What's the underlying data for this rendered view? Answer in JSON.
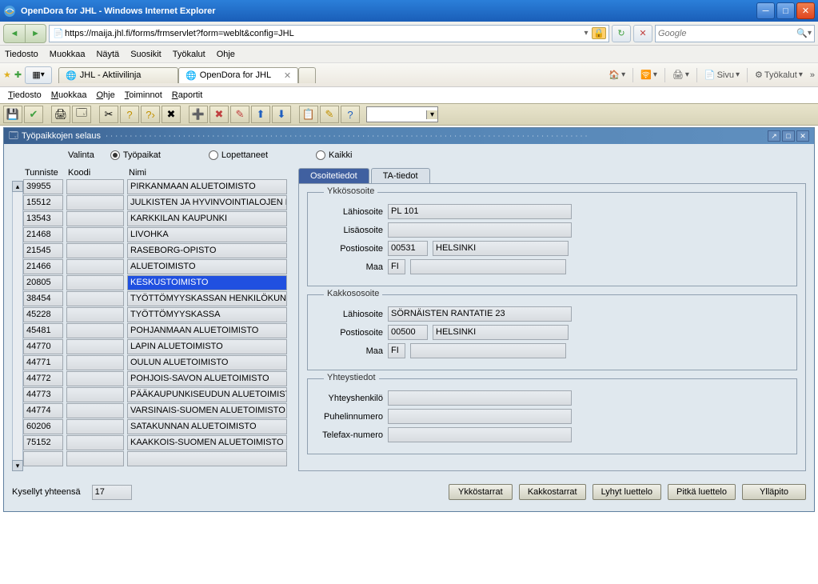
{
  "window": {
    "title": "OpenDora for JHL - Windows Internet Explorer"
  },
  "address": {
    "url": "https://maija.jhl.fi/forms/frmservlet?form=weblt&config=JHL"
  },
  "search": {
    "placeholder": "Google"
  },
  "browser_menu": [
    "Tiedosto",
    "Muokkaa",
    "Näytä",
    "Suosikit",
    "Työkalut",
    "Ohje"
  ],
  "tabs": [
    {
      "label": "JHL - Aktiivilinja",
      "active": false
    },
    {
      "label": "OpenDora for JHL",
      "active": true
    }
  ],
  "right_tools": {
    "sivu": "Sivu",
    "tyokalut": "Työkalut"
  },
  "app_menu": [
    {
      "u": "T",
      "rest": "iedosto"
    },
    {
      "u": "M",
      "rest": "uokkaa"
    },
    {
      "u": "O",
      "rest": "hje"
    },
    {
      "u": "T",
      "rest": "oiminnot"
    },
    {
      "u": "R",
      "rest": "aportit"
    }
  ],
  "subwindow": {
    "title": "Työpaikkojen selaus"
  },
  "filter": {
    "valinta_label": "Valinta",
    "options": [
      {
        "label": "Työpaikat",
        "checked": true
      },
      {
        "label": "Lopettaneet",
        "checked": false
      },
      {
        "label": "Kaikki",
        "checked": false
      }
    ]
  },
  "list": {
    "headers": {
      "tunniste": "Tunniste",
      "koodi": "Koodi",
      "nimi": "Nimi"
    },
    "rows": [
      {
        "tunniste": "39955",
        "koodi": "",
        "nimi": "PIRKANMAAN ALUETOIMISTO",
        "sel": false
      },
      {
        "tunniste": "15512",
        "koodi": "",
        "nimi": "JULKISTEN JA HYVINVOINTIALOJEN LTO",
        "sel": false
      },
      {
        "tunniste": "13543",
        "koodi": "",
        "nimi": "KARKKILAN KAUPUNKI",
        "sel": false
      },
      {
        "tunniste": "21468",
        "koodi": "",
        "nimi": "LIVOHKA",
        "sel": false
      },
      {
        "tunniste": "21545",
        "koodi": "",
        "nimi": "RASEBORG-OPISTO",
        "sel": false
      },
      {
        "tunniste": "21466",
        "koodi": "",
        "nimi": "ALUETOIMISTO",
        "sel": false
      },
      {
        "tunniste": "20805",
        "koodi": "",
        "nimi": "KESKUSTOIMISTO",
        "sel": true
      },
      {
        "tunniste": "38454",
        "koodi": "",
        "nimi": "TYÖTTÖMYYSKASSAN HENKILÖKUNTA",
        "sel": false
      },
      {
        "tunniste": "45228",
        "koodi": "",
        "nimi": "TYÖTTÖMYYSKASSA",
        "sel": false
      },
      {
        "tunniste": "45481",
        "koodi": "",
        "nimi": "POHJANMAAN ALUETOIMISTO",
        "sel": false
      },
      {
        "tunniste": "44770",
        "koodi": "",
        "nimi": "LAPIN ALUETOIMISTO",
        "sel": false
      },
      {
        "tunniste": "44771",
        "koodi": "",
        "nimi": "OULUN ALUETOIMISTO",
        "sel": false
      },
      {
        "tunniste": "44772",
        "koodi": "",
        "nimi": "POHJOIS-SAVON ALUETOIMISTO",
        "sel": false
      },
      {
        "tunniste": "44773",
        "koodi": "",
        "nimi": "PÄÄKAUPUNKISEUDUN ALUETOIMISTO",
        "sel": false
      },
      {
        "tunniste": "44774",
        "koodi": "",
        "nimi": "VARSINAIS-SUOMEN ALUETOIMISTO",
        "sel": false
      },
      {
        "tunniste": "60206",
        "koodi": "",
        "nimi": "SATAKUNNAN ALUETOIMISTO",
        "sel": false
      },
      {
        "tunniste": "75152",
        "koodi": "",
        "nimi": "KAAKKOIS-SUOMEN ALUETOIMISTO MIKK",
        "sel": false
      },
      {
        "tunniste": "",
        "koodi": "",
        "nimi": "",
        "sel": false
      }
    ]
  },
  "detail_tabs": {
    "osoite": "Osoitetiedot",
    "ta": "TA-tiedot"
  },
  "ykkos": {
    "legend": "Ykkösosoite",
    "lahiosoite_lbl": "Lähiosoite",
    "lahiosoite": "PL 101",
    "lisaosoite_lbl": "Lisäosoite",
    "lisaosoite": "",
    "postiosoite_lbl": "Postiosoite",
    "posti_nro": "00531",
    "posti_toimip": "HELSINKI",
    "maa_lbl": "Maa",
    "maa": "FI",
    "maa_nimi": ""
  },
  "kakkos": {
    "legend": "Kakkososoite",
    "lahiosoite_lbl": "Lähiosoite",
    "lahiosoite": "SÖRNÄISTEN RANTATIE 23",
    "postiosoite_lbl": "Postiosoite",
    "posti_nro": "00500",
    "posti_toimip": "HELSINKI",
    "maa_lbl": "Maa",
    "maa": "FI",
    "maa_nimi": ""
  },
  "yht": {
    "legend": "Yhteystiedot",
    "yhteyshenkilo_lbl": "Yhteyshenkilö",
    "yhteyshenkilo": "",
    "puhelin_lbl": "Puhelinnumero",
    "puhelin": "",
    "telefax_lbl": "Telefax-numero",
    "telefax": ""
  },
  "summary": {
    "label": "Kysellyt yhteensä",
    "value": "17"
  },
  "buttons": {
    "ykkostarrat": "Ykköstarrat",
    "kakkostarrat": "Kakkostarrat",
    "lyhyt": "Lyhyt luettelo",
    "pitka": "Pitkä luettelo",
    "yllapito": "Ylläpito"
  }
}
